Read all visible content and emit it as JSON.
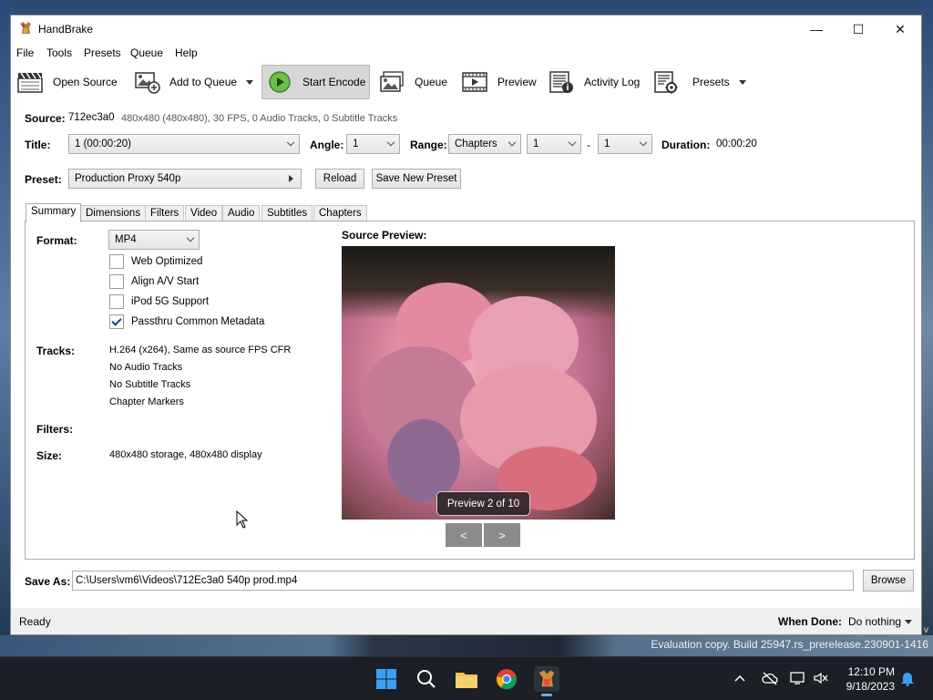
{
  "window": {
    "title": "HandBrake",
    "controls": {
      "minimize": "—",
      "maximize": "☐",
      "close": "✕"
    }
  },
  "menu": [
    "File",
    "Tools",
    "Presets",
    "Queue",
    "Help"
  ],
  "toolbar": {
    "open_source": "Open Source",
    "add_to_queue": "Add to Queue",
    "start_encode": "Start Encode",
    "queue": "Queue",
    "preview": "Preview",
    "activity_log": "Activity Log",
    "presets": "Presets"
  },
  "source": {
    "label": "Source:",
    "name": "712ec3a0",
    "details": "480x480 (480x480), 30 FPS, 0 Audio Tracks, 0 Subtitle Tracks"
  },
  "title_row": {
    "title_label": "Title:",
    "title_value": "1  (00:00:20)",
    "angle_label": "Angle:",
    "angle_value": "1",
    "range_label": "Range:",
    "range_value": "Chapters",
    "range_start": "1",
    "range_sep": "-",
    "range_end": "1",
    "duration_label": "Duration:",
    "duration_value": "00:00:20"
  },
  "preset": {
    "label": "Preset:",
    "value": "Production Proxy 540p",
    "reload": "Reload",
    "save_new": "Save New Preset"
  },
  "tabs": [
    "Summary",
    "Dimensions",
    "Filters",
    "Video",
    "Audio",
    "Subtitles",
    "Chapters"
  ],
  "summary": {
    "format_label": "Format:",
    "format_value": "MP4",
    "options": [
      {
        "label": "Web Optimized",
        "checked": false
      },
      {
        "label": "Align A/V Start",
        "checked": false
      },
      {
        "label": "iPod 5G Support",
        "checked": false
      },
      {
        "label": "Passthru Common Metadata",
        "checked": true
      }
    ],
    "tracks_label": "Tracks:",
    "tracks": [
      "H.264 (x264), Same as source FPS CFR",
      "No Audio Tracks",
      "No Subtitle Tracks",
      "Chapter Markers"
    ],
    "filters_label": "Filters:",
    "size_label": "Size:",
    "size_value": "480x480 storage, 480x480 display"
  },
  "preview": {
    "heading": "Source Preview:",
    "badge": "Preview 2 of 10",
    "prev": "<",
    "next": ">"
  },
  "save_as": {
    "label": "Save As:",
    "value": "C:\\Users\\vm6\\Videos\\712Ec3a0 540p prod.mp4",
    "browse": "Browse"
  },
  "status": {
    "text": "Ready",
    "when_done_label": "When Done:",
    "when_done_value": "Do nothing"
  },
  "desktop": {
    "watermark": "Evaluation copy. Build 25947.rs_prerelease.230901-1416",
    "watermark_top": "v"
  },
  "taskbar": {
    "time": "12:10 PM",
    "date": "9/18/2023"
  }
}
